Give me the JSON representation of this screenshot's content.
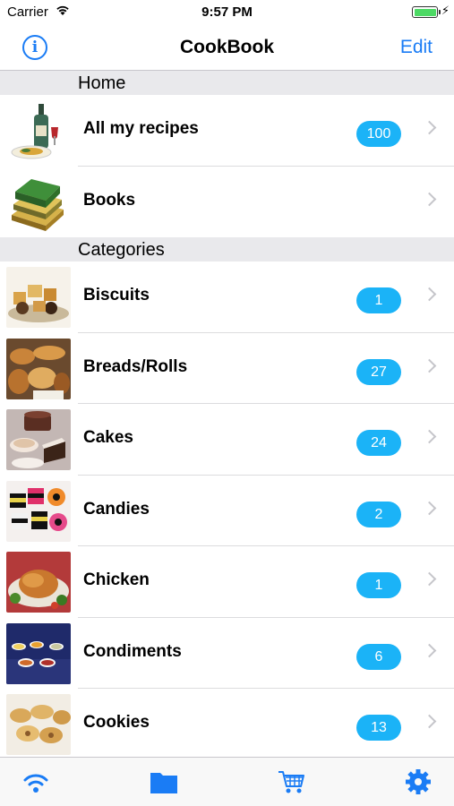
{
  "status_bar": {
    "carrier": "Carrier",
    "time": "9:57 PM"
  },
  "nav": {
    "info_icon": "info-icon",
    "title": "CookBook",
    "edit_label": "Edit"
  },
  "sections": {
    "home": {
      "title": "Home",
      "items": [
        {
          "label": "All my recipes",
          "badge": "100",
          "image": "wine-bottle-and-plate"
        },
        {
          "label": "Books",
          "image": "stack-of-books"
        }
      ]
    },
    "categories": {
      "title": "Categories",
      "items": [
        {
          "label": "Biscuits",
          "badge": "1",
          "image": "biscuits"
        },
        {
          "label": "Breads/Rolls",
          "badge": "27",
          "image": "breads"
        },
        {
          "label": "Cakes",
          "badge": "24",
          "image": "cakes"
        },
        {
          "label": "Candies",
          "badge": "2",
          "image": "candies"
        },
        {
          "label": "Chicken",
          "badge": "1",
          "image": "roast-chicken"
        },
        {
          "label": "Condiments",
          "badge": "6",
          "image": "condiment-bowls"
        },
        {
          "label": "Cookies",
          "badge": "13",
          "image": "cookies"
        }
      ]
    }
  },
  "tab_bar": {
    "tabs": [
      "wifi-icon",
      "folder-icon",
      "cart-icon",
      "gear-icon"
    ]
  },
  "colors": {
    "accent": "#1a7cf5",
    "badge": "#1bb3f7",
    "section_bg": "#e9e9ec"
  }
}
